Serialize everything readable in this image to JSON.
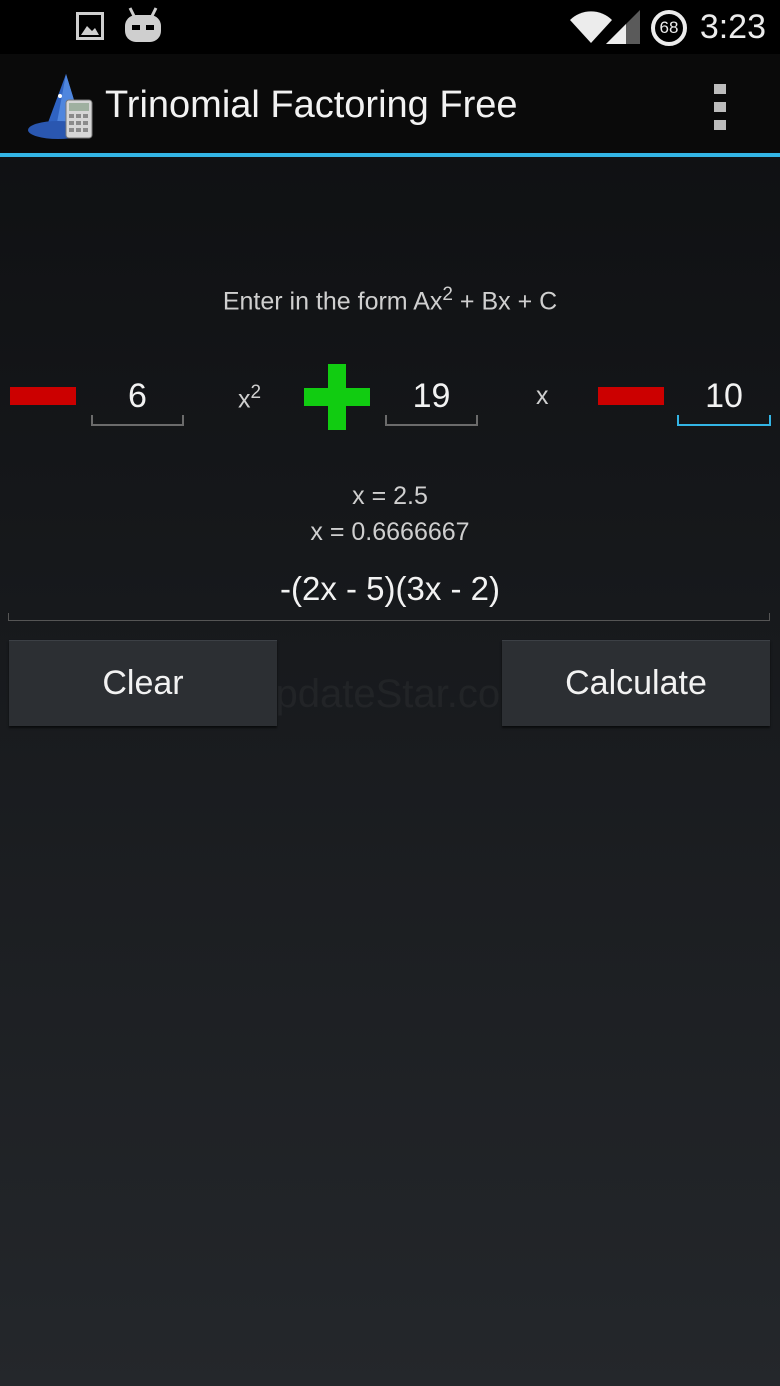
{
  "status_bar": {
    "time": "3:23",
    "battery_level": "68",
    "icons": [
      "image-notification-icon",
      "android-robot-icon",
      "wifi-icon",
      "signal-icon",
      "battery-icon"
    ]
  },
  "action_bar": {
    "title": "Trinomial Factoring Free",
    "icons": [
      "app-logo-icon",
      "overflow-menu-icon"
    ],
    "accent_color": "#33b5e5"
  },
  "form": {
    "hint_prefix": "Enter in the form Ax",
    "hint_exponent": "2",
    "hint_suffix": " + Bx + C",
    "a": {
      "sign": "minus",
      "value": "6"
    },
    "x_squared_base": "x",
    "x_squared_exponent": "2",
    "b": {
      "sign": "plus",
      "value": "19"
    },
    "x_label": "x",
    "c": {
      "sign": "minus",
      "value": "10"
    },
    "sign_colors": {
      "minus": "#cc0000",
      "plus": "#11cc11"
    }
  },
  "results": {
    "roots": [
      "x = 2.5",
      "x = 0.6666667"
    ],
    "factored": "-(2x - 5)(3x - 2)"
  },
  "buttons": {
    "clear": "Clear",
    "calculate": "Calculate"
  },
  "watermark": "UpdateStar.com"
}
